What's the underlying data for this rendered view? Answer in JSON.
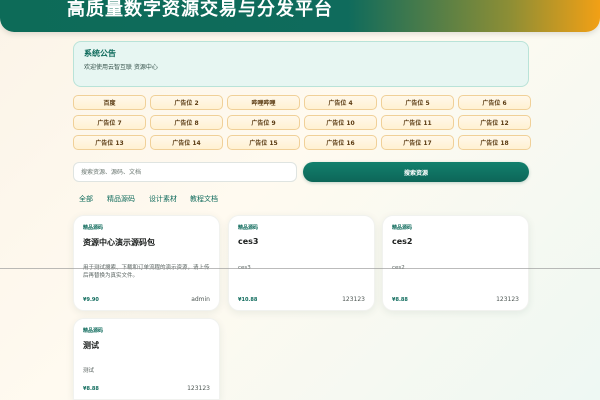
{
  "header": {
    "title": "高质量数字资源交易与分发平台"
  },
  "notice": {
    "title": "系统公告",
    "text": "欢迎使用云智互联 资源中心"
  },
  "ads": [
    "百度",
    "广告位 2",
    "哔哩哔哩",
    "广告位 4",
    "广告位 5",
    "广告位 6",
    "广告位 7",
    "广告位 8",
    "广告位 9",
    "广告位 10",
    "广告位 11",
    "广告位 12",
    "广告位 13",
    "广告位 14",
    "广告位 15",
    "广告位 16",
    "广告位 17",
    "广告位 18"
  ],
  "search": {
    "placeholder": "搜索资源、源码、文档",
    "button": "搜索资源"
  },
  "categories": [
    "全部",
    "精品源码",
    "设计素材",
    "教程文档"
  ],
  "cards": [
    {
      "tag": "精品源码",
      "title": "资源中心演示源码包",
      "description": "用于测试搜索、下载和订单流程的演示资源，请上传后再替换为真实文件。",
      "price": "¥9.90",
      "author": "admin"
    },
    {
      "tag": "精品源码",
      "title": "ces3",
      "description": "ces3",
      "price": "¥10.88",
      "author": "123123"
    },
    {
      "tag": "精品源码",
      "title": "ces2",
      "description": "ces2",
      "price": "¥8.88",
      "author": "123123"
    },
    {
      "tag": "精品源码",
      "title": "测试",
      "description": "测试",
      "price": "¥8.88",
      "author": "123123"
    }
  ],
  "colors": {
    "primary": "#0f6b5c",
    "accent": "#f2a015",
    "notice_background": "#e7f6f2",
    "ad_background": "#fff1d2"
  }
}
